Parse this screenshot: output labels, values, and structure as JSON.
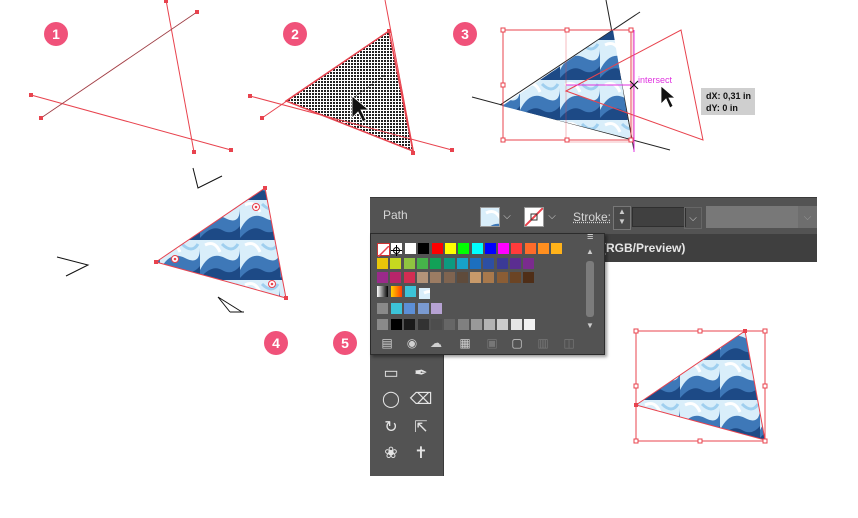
{
  "steps": [
    "1",
    "2",
    "3",
    "4",
    "5"
  ],
  "control_bar": {
    "object_type": "Path",
    "stroke_label": "Stroke:"
  },
  "document_tab": {
    "title": "(RGB/Preview)"
  },
  "measure_tooltip": {
    "dx": "dX: 0,31 in",
    "dy": "dY: 0 in"
  },
  "smart_guide": {
    "label": "intersect"
  },
  "colors": {
    "accent": "#f0527a",
    "path_red": "#e8434e",
    "panel_bg": "#535353",
    "smart_guide": "#e033e0",
    "pattern_dark": "#1f4f8a",
    "pattern_light": "#cfe8f7"
  },
  "swatches": {
    "row1": [
      "#ffffff",
      "#000000",
      "#ff0000",
      "#ffff00",
      "#00ff00",
      "#00ffff",
      "#0000ff",
      "#ff00ff",
      "#ff3b3b",
      "#ff6b2a",
      "#ff8f1f",
      "#ffb21a"
    ],
    "row2": [
      "#e8c60a",
      "#c6d91f",
      "#8fc440",
      "#46b34a",
      "#12a157",
      "#0d9a7f",
      "#17a2c8",
      "#1c6fbf",
      "#2d4fa3",
      "#3b3a96",
      "#5b2d91",
      "#7b2b8e"
    ],
    "row3": [
      "#9b2a8a",
      "#b8246a",
      "#d22d52",
      "#b39479",
      "#9c7c63",
      "#7f6450",
      "#5f4b3b",
      "#c89a6a",
      "#a8794c",
      "#8a5d35",
      "#6b4424",
      "#4f2e17"
    ],
    "grays": [
      "#000000",
      "#1a1a1a",
      "#333333",
      "#4d4d4d",
      "#666666",
      "#808080",
      "#999999",
      "#b3b3b3",
      "#cccccc",
      "#e6e6e6",
      "#f2f2f2"
    ],
    "group1": [
      "#3cc3d8",
      "#5c8fd6",
      "#7a9ad0",
      "#b6a2d3"
    ]
  },
  "tools": {
    "icons": [
      "rectangle-icon",
      "paintbrush-icon",
      "blob-brush-icon",
      "eraser-icon",
      "rotate-icon",
      "scale-icon",
      "puppet-warp-icon",
      "pin-icon"
    ]
  },
  "panel_buttons": [
    "swatch-libraries-icon",
    "show-kinds-icon",
    "cloud-icon",
    "color-group-icon",
    "new-group-icon",
    "folder-icon",
    "new-swatch-icon",
    "delete-icon"
  ]
}
